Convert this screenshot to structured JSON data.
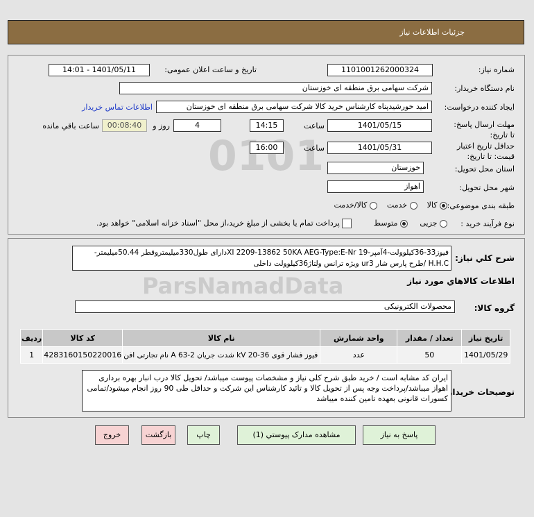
{
  "header": {
    "title": "جزئیات اطلاعات نیاز"
  },
  "form": {
    "need_number_label": "شماره نیاز:",
    "need_number": "1101001262000324",
    "announce_label": "تاریخ و ساعت اعلان عمومی:",
    "announce_value": "1401/05/11 - 14:01",
    "buyer_org_label": "نام دستگاه خریدار:",
    "buyer_org": "شرکت سهامی برق منطقه ای خوزستان",
    "creator_label": "ایجاد کننده درخواست:",
    "creator": "امید خورشیدپناه کارشناس خرید کالا شرکت سهامی برق منطقه ای خوزستان",
    "contact_link": "اطلاعات تماس خریدار",
    "deadline_label": "مهلت ارسال پاسخ: تا تاریخ:",
    "deadline_date": "1401/05/15",
    "time_label": "ساعت",
    "deadline_time": "14:15",
    "days": "4",
    "days_label": "روز و",
    "remaining": "00:08:40",
    "remaining_label": "ساعت باقي مانده",
    "validity_label": "حداقل تاریخ اعتبار قیمت: تا تاریخ:",
    "validity_date": "1401/05/31",
    "validity_time": "16:00",
    "province_label": "استان محل تحویل:",
    "province": "خوزستان",
    "city_label": "شهر محل تحویل:",
    "city": "اهواز",
    "category_label": "طبقه بندی موضوعی:",
    "category_options": [
      "کالا",
      "خدمت",
      "کالا/خدمت"
    ],
    "category_selected": "کالا",
    "process_label": "نوع فرآیند خرید :",
    "process_options": [
      "جزیی",
      "متوسط"
    ],
    "process_selected": "متوسط",
    "payment_note": "پرداخت تمام یا بخشی از مبلغ خرید،از محل \"اسناد خزانه اسلامی\" خواهد بود.",
    "payment_checked": false
  },
  "details": {
    "desc_label": "شرح كلي نياز:",
    "desc_line1": "فیوز33-36کیلوولت-4آمپر-19 XI 2209-13862 50KA AEG-Type:E-Nrدارای طول330میلیمتروقطر 50.44میلیمتر-",
    "desc_line2": "H.H.C /طرح پارس شار ur3 ویژه ترانس ولتاژ36کیلوولت داخلی",
    "goods_title": "اطلاعات كالاهاي مورد نياز",
    "group_label": "گروه کالا:",
    "group": "محصولات الکترونیکی",
    "table": {
      "headers": [
        "ردیف",
        "کد کالا",
        "نام کالا",
        "واحد شمارش",
        "تعداد / مقدار",
        "تاریخ نیاز"
      ],
      "rows": [
        [
          "1",
          "4283160150220016",
          "فیوز فشار قوی 36-20 kV شدت جریان 2-63 A نام تجارتی افن",
          "عدد",
          "50",
          "1401/05/29"
        ]
      ]
    },
    "notes_label": "توضیحات خریدار:",
    "notes": "ایران کد مشابه است / خرید طبق شرح کلی نیاز و مشخصات پیوست میباشد/ تحویل کالا درب انبار بهره برداری اهواز میباشد/پرداخت وجه پس از تحویل کالا و تائید کارشناس این شرکت و حداقل طی 90 روز انجام میشود/تمامی کسورات قانونی بعهده تامین کننده میباشد"
  },
  "buttons": {
    "reply": "پاسخ به نیاز",
    "attachments": "مشاهده مدارک پیوستي (1)",
    "print": "چاپ",
    "back": "بازگشت",
    "exit": "خروج"
  },
  "watermark": "ParsNamadData"
}
